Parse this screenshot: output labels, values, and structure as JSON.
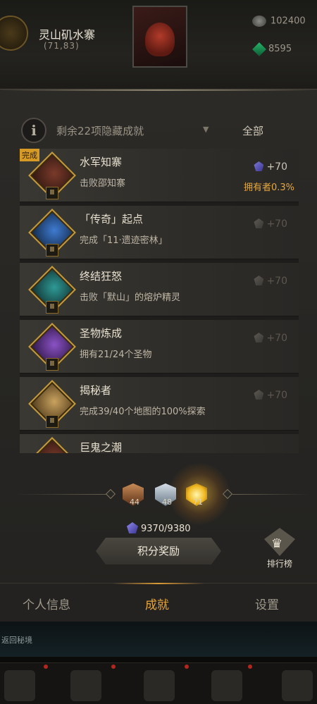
{
  "hud": {
    "location_name": "灵山矶水寨",
    "location_coord": "(71,83)",
    "resources": [
      {
        "icon": "silver-coin-icon",
        "value": "102400"
      },
      {
        "icon": "green-gem-icon",
        "value": "8595"
      }
    ]
  },
  "filter": {
    "summary": "剩余22项隐藏成就",
    "selected": "全部",
    "info_icon": "i"
  },
  "achievements": [
    {
      "title": "水军知寨",
      "desc": "击败邵知寨",
      "points": "+70",
      "owner": "拥有者0.3%",
      "done": true,
      "done_tag": "完成"
    },
    {
      "title": "「传奇」起点",
      "desc": "完成「11·遗迹密林」",
      "points": "+70",
      "done": false
    },
    {
      "title": "终结狂怒",
      "desc": "击败「默山」的熔炉精灵",
      "points": "+70",
      "done": false
    },
    {
      "title": "圣物炼成",
      "desc": "拥有21/24个圣物",
      "points": "+70",
      "done": false
    },
    {
      "title": "揭秘者",
      "desc": "完成39/40个地图的100%探索",
      "points": "+70",
      "done": false
    },
    {
      "title": "巨鬼之潮",
      "desc": "",
      "points": "",
      "done": false
    }
  ],
  "tiers": {
    "bronze": "44",
    "silver": "48",
    "gold": "71"
  },
  "score": "9370/9380",
  "reward_button": "积分奖励",
  "ranking_button": "排行榜",
  "tabs": [
    "个人信息",
    "成就",
    "设置"
  ],
  "back_label": "返回秘境",
  "colors": {
    "accent": "#e6a53b",
    "owner": "#e8a83a",
    "done_tag": "#d79b25"
  }
}
